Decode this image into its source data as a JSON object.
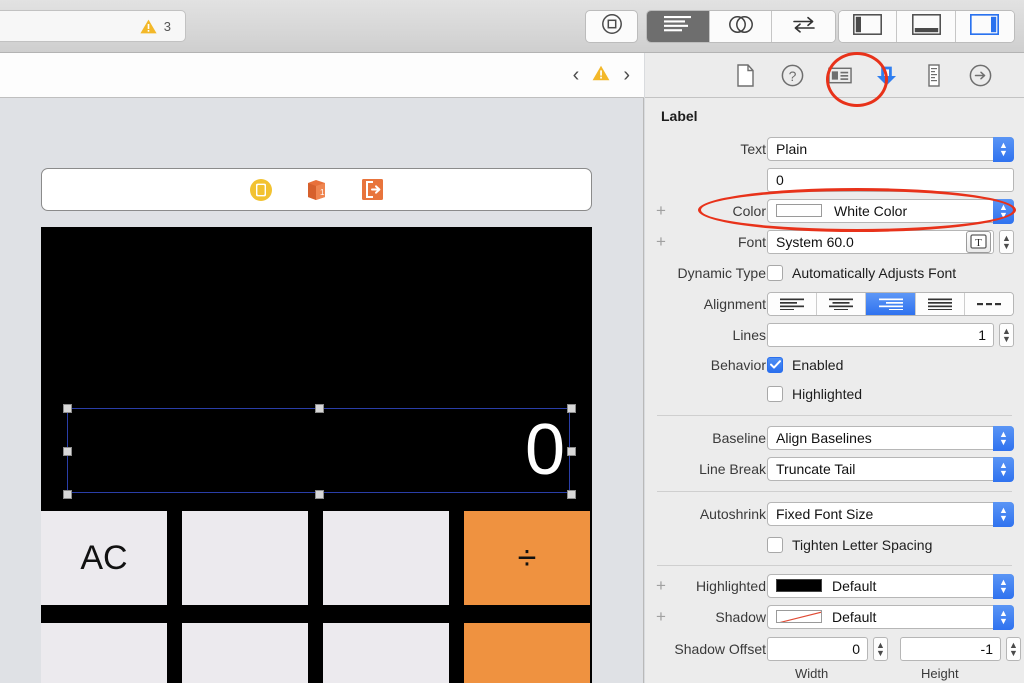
{
  "toolbar": {
    "status": {
      "icon": "warning-triangle-icon",
      "count": "3"
    },
    "buttons": {
      "stop": "stop-icon",
      "standard_editor": "standard-editor-icon",
      "assistant_editor": "assistant-editor-icon",
      "version_editor": "version-editor-icon",
      "navigator_toggle": "left-panel-icon",
      "debug_toggle": "bottom-panel-icon",
      "utilities_toggle": "right-panel-icon"
    }
  },
  "editor_bar": {
    "prev": "‹",
    "warning_icon": "warning-triangle-icon",
    "next": "›"
  },
  "canvas": {
    "scene_dock": [
      {
        "name": "view-controller-icon"
      },
      {
        "name": "first-responder-icon",
        "badge": "1"
      },
      {
        "name": "exit-icon"
      }
    ],
    "display_value": "0",
    "keys_row1": [
      {
        "label": "AC",
        "style": "normal"
      },
      {
        "label": "",
        "style": "normal"
      },
      {
        "label": "",
        "style": "normal"
      },
      {
        "label": "÷",
        "style": "operator"
      }
    ],
    "keys_row2": [
      {
        "label": "",
        "style": "normal"
      },
      {
        "label": "",
        "style": "normal"
      },
      {
        "label": "",
        "style": "normal"
      },
      {
        "label": "",
        "style": "operator"
      }
    ]
  },
  "inspector": {
    "tabs": [
      {
        "name": "file-inspector-icon",
        "selected": false
      },
      {
        "name": "quick-help-inspector-icon",
        "selected": false
      },
      {
        "name": "identity-inspector-icon",
        "selected": false
      },
      {
        "name": "attributes-inspector-icon",
        "selected": true
      },
      {
        "name": "size-inspector-icon",
        "selected": false
      },
      {
        "name": "connections-inspector-icon",
        "selected": false
      }
    ],
    "section_title": "Label",
    "fields": {
      "text_label": "Text",
      "text_value": "Plain",
      "content_value": "0",
      "color_label": "Color",
      "color_value": "White Color",
      "color_swatch": "#ffffff",
      "font_label": "Font",
      "font_value": "System 60.0",
      "dynamic_type_label": "Dynamic Type",
      "dynamic_type_checkbox": "Automatically Adjusts Font",
      "dynamic_type_checked": false,
      "alignment_label": "Alignment",
      "alignment_options": [
        "left",
        "center",
        "right",
        "justified",
        "natural"
      ],
      "alignment_selected": "right",
      "lines_label": "Lines",
      "lines_value": "1",
      "behavior_label": "Behavior",
      "behavior_enabled_label": "Enabled",
      "behavior_enabled_checked": true,
      "behavior_highlighted_label": "Highlighted",
      "behavior_highlighted_checked": false,
      "baseline_label": "Baseline",
      "baseline_value": "Align Baselines",
      "linebreak_label": "Line Break",
      "linebreak_value": "Truncate Tail",
      "autoshrink_label": "Autoshrink",
      "autoshrink_value": "Fixed Font Size",
      "tighten_label": "Tighten Letter Spacing",
      "tighten_checked": false,
      "highlighted_label": "Highlighted",
      "highlighted_value": "Default",
      "highlighted_swatch": "#000000",
      "shadow_label": "Shadow",
      "shadow_value": "Default",
      "shadow_offset_label": "Shadow Offset",
      "shadow_offset_width": "0",
      "shadow_offset_height": "-1",
      "width_caption": "Width",
      "height_caption": "Height"
    }
  },
  "annotations": {
    "accent_color": "#e8321a",
    "marks": [
      {
        "target": "attributes-inspector-icon"
      },
      {
        "target": "color-row"
      }
    ]
  }
}
